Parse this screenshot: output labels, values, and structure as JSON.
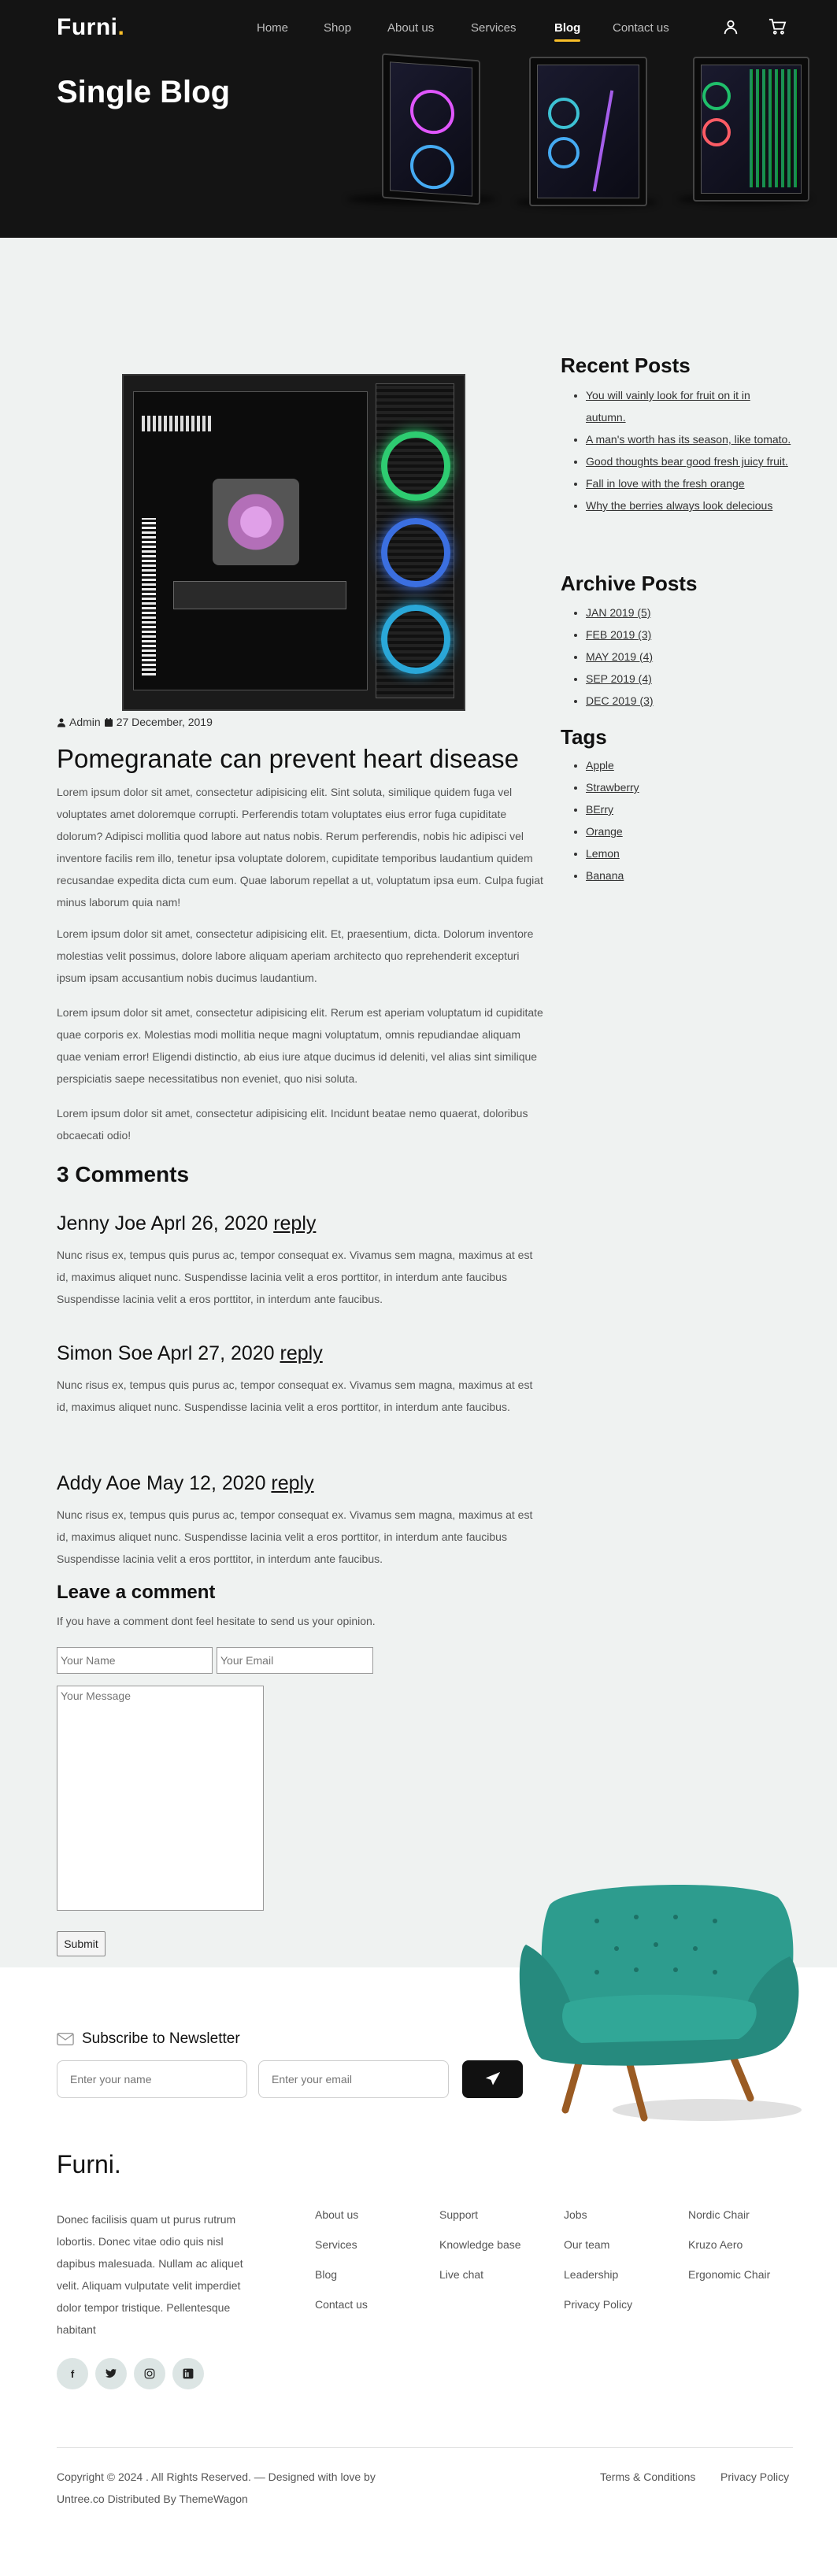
{
  "header": {
    "logo": "Furni",
    "logo_dot": ".",
    "nav": [
      "Home",
      "Shop",
      "About us",
      "Services",
      "Blog",
      "Contact us"
    ],
    "active_nav": "Blog",
    "icons": [
      "user-icon",
      "cart-icon"
    ],
    "hero_title": "Single Blog"
  },
  "post": {
    "author": "Admin",
    "date": "27 December, 2019",
    "title": "Pomegranate can prevent heart disease",
    "paragraphs": [
      "Lorem ipsum dolor sit amet, consectetur adipisicing elit. Sint soluta, similique quidem fuga vel voluptates amet doloremque corrupti. Perferendis totam voluptates eius error fuga cupiditate dolorum? Adipisci mollitia quod labore aut natus nobis. Rerum perferendis, nobis hic adipisci vel inventore facilis rem illo, tenetur ipsa voluptate dolorem, cupiditate temporibus laudantium quidem recusandae expedita dicta cum eum. Quae laborum repellat a ut, voluptatum ipsa eum. Culpa fugiat minus laborum quia nam!",
      "Lorem ipsum dolor sit amet, consectetur adipisicing elit. Et, praesentium, dicta. Dolorum inventore molestias velit possimus, dolore labore aliquam aperiam architecto quo reprehenderit excepturi ipsum ipsam accusantium nobis ducimus laudantium.",
      "Lorem ipsum dolor sit amet, consectetur adipisicing elit. Rerum est aperiam voluptatum id cupiditate quae corporis ex. Molestias modi mollitia neque magni voluptatum, omnis repudiandae aliquam quae veniam error! Eligendi distinctio, ab eius iure atque ducimus id deleniti, vel alias sint similique perspiciatis saepe necessitatibus non eveniet, quo nisi soluta.",
      "Lorem ipsum dolor sit amet, consectetur adipisicing elit. Incidunt beatae nemo quaerat, doloribus obcaecati odio!"
    ]
  },
  "comments": {
    "heading": "3 Comments",
    "reply_label": "reply",
    "items": [
      {
        "head": "Jenny Joe Aprl 26, 2020",
        "body": "Nunc risus ex, tempus quis purus ac, tempor consequat ex. Vivamus sem magna, maximus at est id, maximus aliquet nunc. Suspendisse lacinia velit a eros porttitor, in interdum ante faucibus Suspendisse lacinia velit a eros porttitor, in interdum ante faucibus."
      },
      {
        "head": "Simon Soe Aprl 27, 2020",
        "body": "Nunc risus ex, tempus quis purus ac, tempor consequat ex. Vivamus sem magna, maximus at est id, maximus aliquet nunc. Suspendisse lacinia velit a eros porttitor, in interdum ante faucibus."
      },
      {
        "head": "Addy Aoe May 12, 2020",
        "body": "Nunc risus ex, tempus quis purus ac, tempor consequat ex. Vivamus sem magna, maximus at est id, maximus aliquet nunc. Suspendisse lacinia velit a eros porttitor, in interdum ante faucibus Suspendisse lacinia velit a eros porttitor, in interdum ante faucibus."
      }
    ]
  },
  "comment_form": {
    "heading": "Leave a comment",
    "subtitle": "If you have a comment dont feel hesitate to send us your opinion.",
    "name_placeholder": "Your Name",
    "email_placeholder": "Your Email",
    "message_placeholder": "Your Message",
    "submit_label": "Submit"
  },
  "sidebar": {
    "recent_heading": "Recent Posts",
    "recent": [
      "You will vainly look for fruit on it in autumn.",
      "A man's worth has its season, like tomato.",
      "Good thoughts bear good fresh juicy fruit.",
      "Fall in love with the fresh orange",
      "Why the berries always look delecious"
    ],
    "archive_heading": "Archive Posts",
    "archive": [
      "JAN 2019 (5)",
      "FEB 2019 (3)",
      "MAY 2019 (4)",
      "SEP 2019 (4)",
      "DEC 2019 (3)"
    ],
    "tags_heading": "Tags",
    "tags": [
      "Apple",
      "Strawberry",
      "BErry",
      "Orange",
      "Lemon",
      "Banana"
    ]
  },
  "newsletter": {
    "title": "Subscribe to Newsletter",
    "name_placeholder": "Enter your name",
    "email_placeholder": "Enter your email",
    "icon": "envelope-icon",
    "button_icon": "paper-plane-icon"
  },
  "footer": {
    "logo": "Furni.",
    "description": "Donec facilisis quam ut purus rutrum lobortis. Donec vitae odio quis nisl dapibus malesuada. Nullam ac aliquet velit. Aliquam vulputate velit imperdiet dolor tempor tristique. Pellentesque habitant",
    "socials": [
      "f",
      "t",
      "ig",
      "in"
    ],
    "col1": [
      "About us",
      "Services",
      "Blog",
      "Contact us"
    ],
    "col2": [
      "Support",
      "Knowledge base",
      "Live chat"
    ],
    "col3": [
      "Jobs",
      "Our team",
      "Leadership",
      "Privacy Policy"
    ],
    "col4": [
      "Nordic Chair",
      "Kruzo Aero",
      "Ergonomic Chair"
    ],
    "copyright": "Copyright © 2024 . All Rights Reserved. — Designed with love by Untree.co Distributed By ThemeWagon",
    "terms": "Terms & Conditions",
    "privacy": "Privacy Policy"
  },
  "colors": {
    "header_bg": "#141414",
    "accent": "#f9bf29",
    "main_bg": "#eff2f1",
    "chair": "#2d9c8e"
  }
}
